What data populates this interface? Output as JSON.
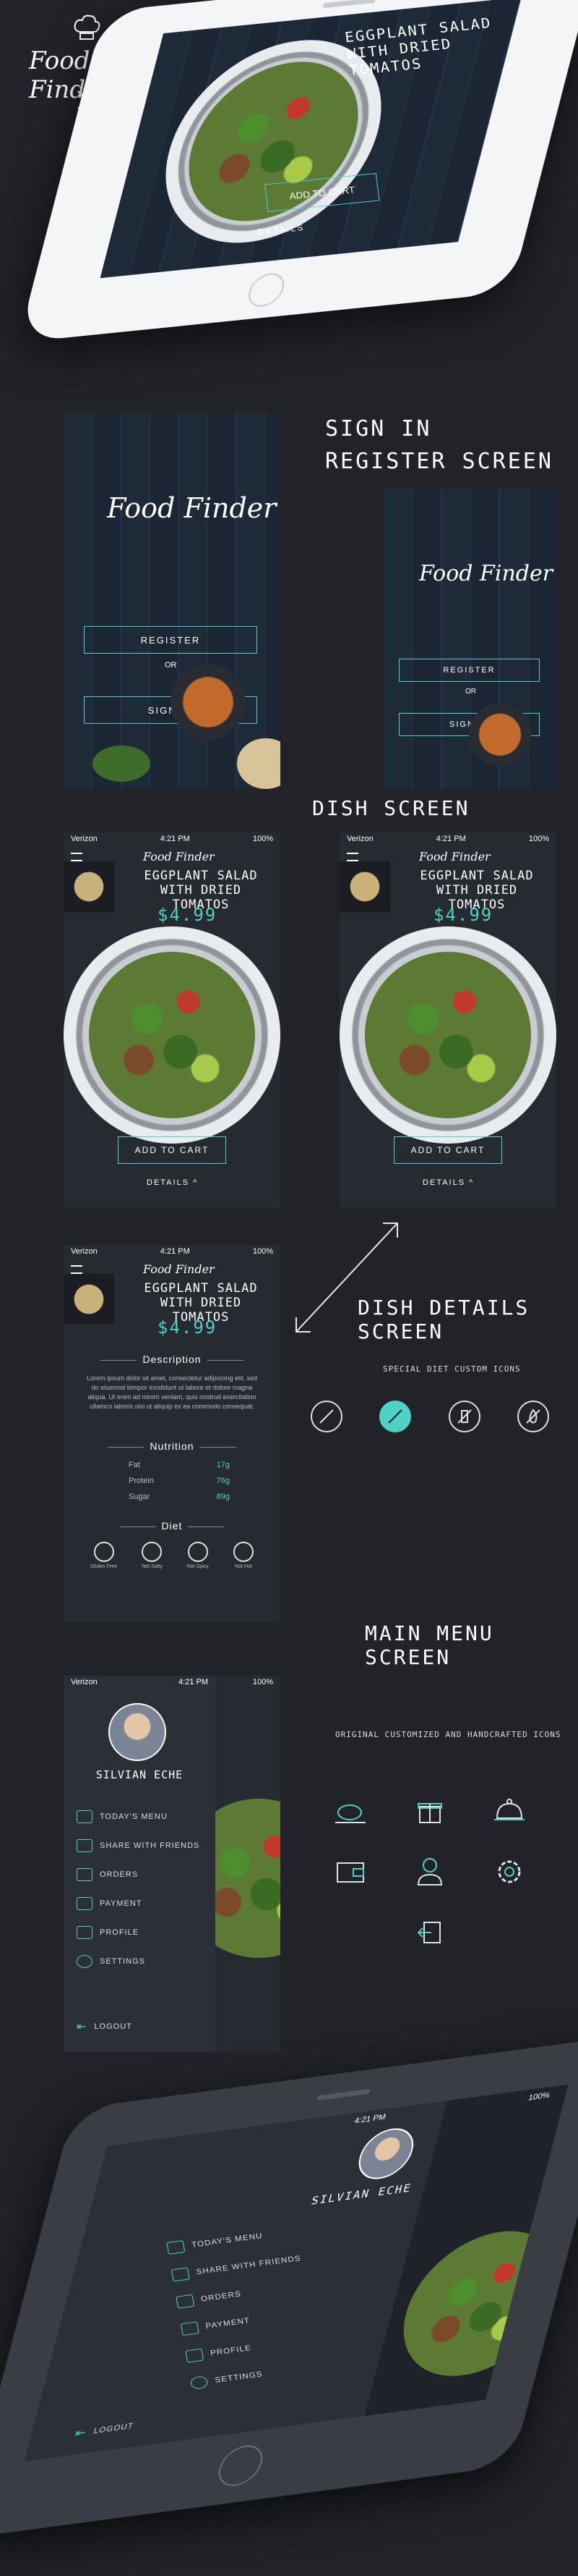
{
  "brand": {
    "logo_text": "Food Finder"
  },
  "colors": {
    "background": "#212329",
    "accent": "#4fd1c5",
    "screen": "#262a31"
  },
  "status_bar": {
    "carrier": "Verizon",
    "time": "4:21 PM",
    "battery": "100%"
  },
  "section_titles": {
    "signin": "SIGN IN",
    "register": "REGISTER SCREEN",
    "dish": "DISH SCREEN",
    "dish_details": "DISH DETAILS SCREEN",
    "main_menu": "MAIN MENU SCREEN"
  },
  "auth": {
    "register_label": "REGISTER",
    "or_label": "OR",
    "signin_label": "SIGN IN"
  },
  "dish": {
    "name_line1": "EGGPLANT SALAD",
    "name_line2": "WITH DRIED TOMATOS",
    "price": "$4.99",
    "add_to_cart": "ADD TO CART",
    "details": "DETAILS"
  },
  "details": {
    "description_heading": "Description",
    "description_text": "Lorem ipsum dolor sit amet, consectetur adipiscing elit, sed do eiusmod tempor incididunt ut labore et dolore magna aliqua. Ut enim ad minim veniam, quis nostrud exercitation ullamco laboris nisi ut aliquip ex ea commodo consequat.",
    "nutrition_heading": "Nutrition",
    "nutrition": [
      {
        "label": "Fat",
        "value": "17g"
      },
      {
        "label": "Protein",
        "value": "76g"
      },
      {
        "label": "Sugar",
        "value": "89g"
      }
    ],
    "diet_heading": "Diet",
    "diet_items": [
      {
        "label": "Gluten Free",
        "icon": "no-gluten-icon"
      },
      {
        "label": "Not Salty",
        "icon": "no-salt-icon"
      },
      {
        "label": "Not Spicy",
        "icon": "no-spice-icon"
      },
      {
        "label": "Not Hot",
        "icon": "no-fire-icon"
      }
    ]
  },
  "special_icons_caption": "SPECIAL DIET CUSTOM ICONS",
  "original_icons_caption": "ORIGINAL CUSTOMIZED AND HANDCRAFTED ICONS",
  "menu": {
    "user_name": "SILVIAN ECHE",
    "items": [
      {
        "label": "TODAY'S MENU",
        "icon": "dish-icon"
      },
      {
        "label": "SHARE WITH FRIENDS",
        "icon": "gift-icon"
      },
      {
        "label": "ORDERS",
        "icon": "cloche-icon"
      },
      {
        "label": "PAYMENT",
        "icon": "wallet-icon"
      },
      {
        "label": "PROFILE",
        "icon": "user-icon"
      },
      {
        "label": "SETTINGS",
        "icon": "gear-icon"
      }
    ],
    "logout": "LOGOUT"
  }
}
